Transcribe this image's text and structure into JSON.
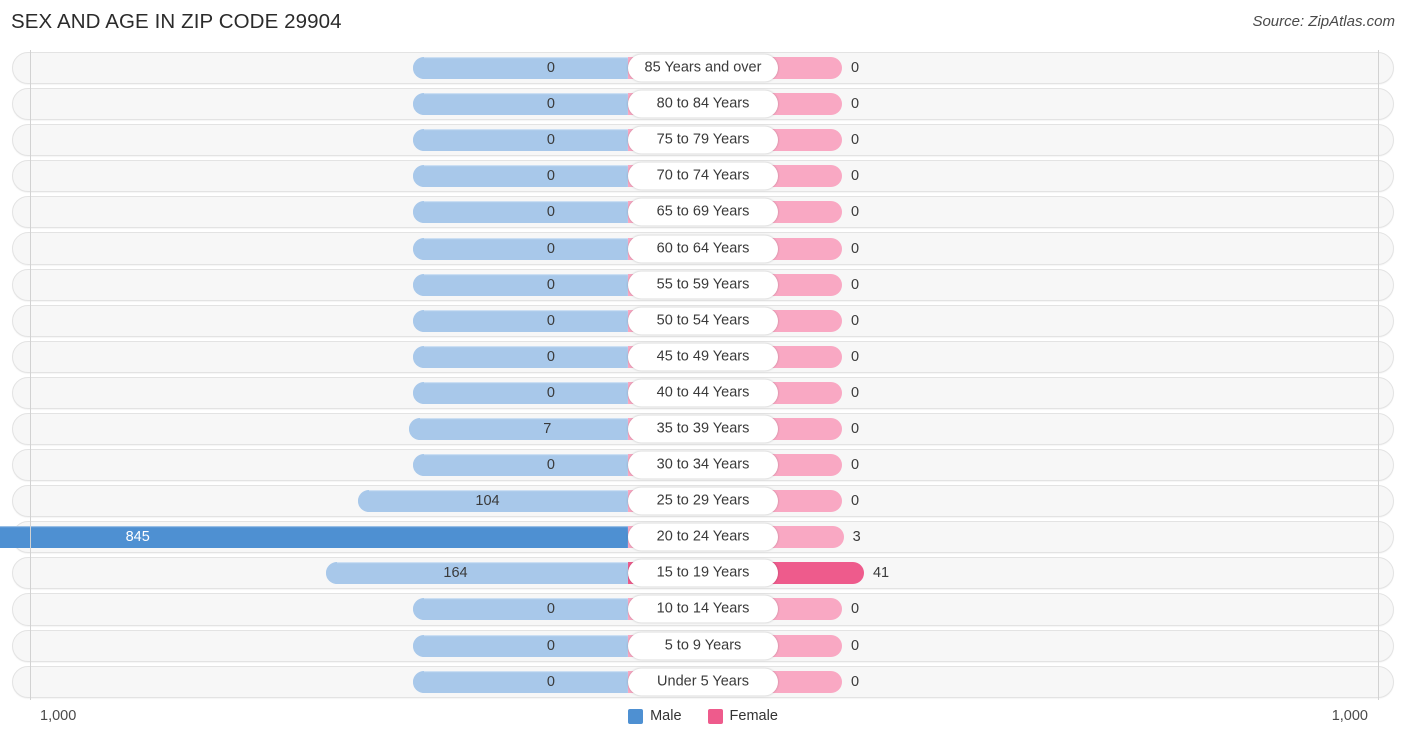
{
  "header": {
    "title": "SEX AND AGE IN ZIP CODE 29904",
    "source": "Source: ZipAtlas.com"
  },
  "footer": {
    "left_tick": "1,000",
    "right_tick": "1,000",
    "legend": [
      {
        "label": "Male",
        "color": "#4e90d2",
        "icon": "male-swatch"
      },
      {
        "label": "Female",
        "color": "#ee5b8c",
        "icon": "female-swatch"
      }
    ]
  },
  "chart_data": {
    "type": "bar",
    "title": "SEX AND AGE IN ZIP CODE 29904",
    "subtitle": "Source: ZipAtlas.com",
    "orientation": "horizontal",
    "style": "population-pyramid",
    "xlabel": "",
    "ylabel": "",
    "axis_max": 1000,
    "axis_ticks": [
      "1,000",
      "1,000"
    ],
    "xlim": [
      -1000,
      1000
    ],
    "grid": false,
    "legend_position": "bottom-center",
    "categories": [
      "85 Years and over",
      "80 to 84 Years",
      "75 to 79 Years",
      "70 to 74 Years",
      "65 to 69 Years",
      "60 to 64 Years",
      "55 to 59 Years",
      "50 to 54 Years",
      "45 to 49 Years",
      "40 to 44 Years",
      "35 to 39 Years",
      "30 to 34 Years",
      "25 to 29 Years",
      "20 to 24 Years",
      "15 to 19 Years",
      "10 to 14 Years",
      "5 to 9 Years",
      "Under 5 Years"
    ],
    "series": [
      {
        "name": "Male",
        "color": "#4e90d2",
        "muted_color": "#a8c8ea",
        "values": [
          0,
          0,
          0,
          0,
          0,
          0,
          0,
          0,
          0,
          0,
          7,
          0,
          104,
          845,
          164,
          0,
          0,
          0
        ],
        "labels": [
          "0",
          "0",
          "0",
          "0",
          "0",
          "0",
          "0",
          "0",
          "0",
          "0",
          "7",
          "0",
          "104",
          "845",
          "164",
          "0",
          "0",
          "0"
        ]
      },
      {
        "name": "Female",
        "color": "#ee5b8c",
        "muted_color": "#f9a8c3",
        "values": [
          0,
          0,
          0,
          0,
          0,
          0,
          0,
          0,
          0,
          0,
          0,
          0,
          0,
          3,
          41,
          0,
          0,
          0
        ],
        "labels": [
          "0",
          "0",
          "0",
          "0",
          "0",
          "0",
          "0",
          "0",
          "0",
          "0",
          "0",
          "0",
          "0",
          "3",
          "41",
          "0",
          "0",
          "0"
        ]
      }
    ]
  }
}
